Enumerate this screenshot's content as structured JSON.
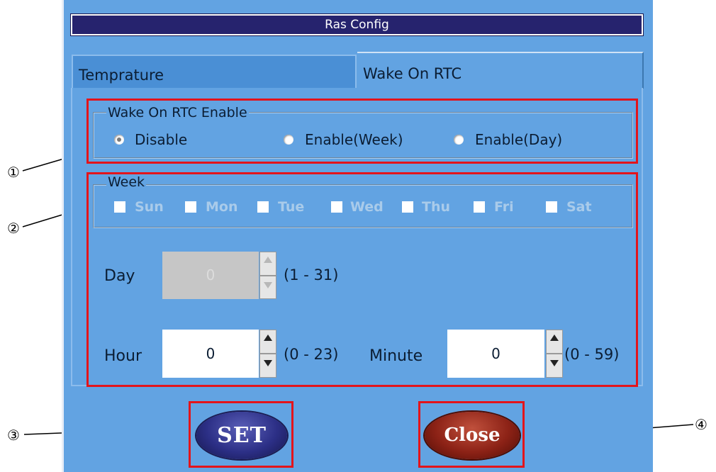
{
  "window": {
    "title": "Ras Config"
  },
  "tabs": [
    {
      "label": "Temprature",
      "active": false
    },
    {
      "label": "Wake On RTC",
      "active": true
    }
  ],
  "wake_enable": {
    "legend": "Wake On RTC Enable",
    "options": [
      {
        "label": "Disable",
        "selected": true
      },
      {
        "label": "Enable(Week)",
        "selected": false
      },
      {
        "label": "Enable(Day)",
        "selected": false
      }
    ]
  },
  "week": {
    "legend": "Week",
    "days": [
      "Sun",
      "Mon",
      "Tue",
      "Wed",
      "Thu",
      "Fri",
      "Sat"
    ]
  },
  "day": {
    "label": "Day",
    "value": "0",
    "range": "(1 - 31)",
    "enabled": false
  },
  "hour": {
    "label": "Hour",
    "value": "0",
    "range": "(0 - 23)"
  },
  "minute": {
    "label": "Minute",
    "value": "0",
    "range": "(0 - 59)"
  },
  "buttons": {
    "set": "SET",
    "close": "Close"
  },
  "callouts": [
    "①",
    "②",
    "③",
    "④"
  ],
  "colors": {
    "window_bg": "#62a3e2",
    "titlebar": "#26236e",
    "highlight": "#e3141b",
    "set_button": "#2c2f86",
    "close_button": "#8c2216"
  }
}
